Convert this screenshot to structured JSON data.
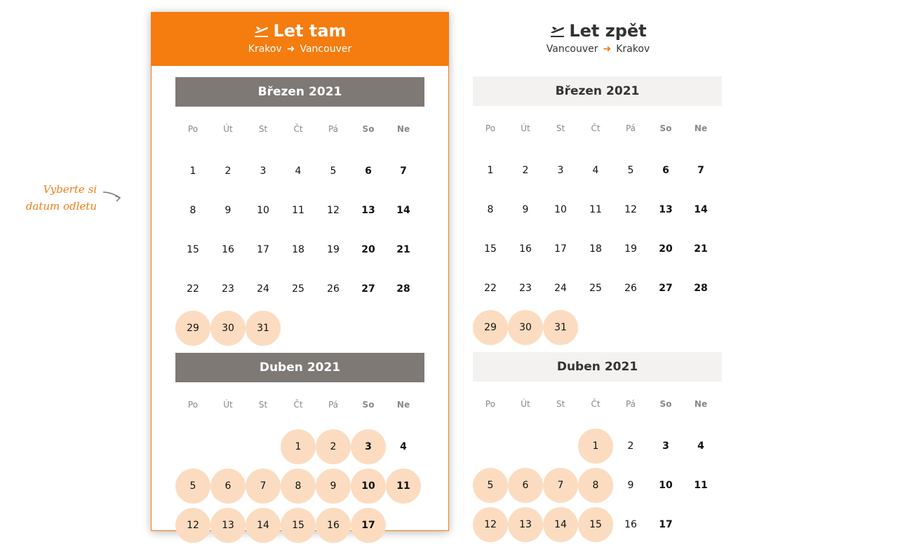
{
  "hint": {
    "text": "Vyberte si datum odletu"
  },
  "columns": [
    {
      "key": "out",
      "title": "Let tam",
      "from": "Krakov",
      "to": "Vancouver",
      "months": [
        {
          "name": "Březen",
          "year": "2021",
          "first_weekday": 0,
          "days": 31,
          "available": [
            29,
            30,
            31
          ]
        },
        {
          "name": "Duben",
          "year": "2021",
          "first_weekday": 3,
          "days": 17,
          "available": [
            1,
            2,
            3,
            5,
            6,
            7,
            8,
            9,
            10,
            11,
            12,
            13,
            14,
            15,
            16,
            17
          ]
        }
      ]
    },
    {
      "key": "ret",
      "title": "Let zpět",
      "from": "Vancouver",
      "to": "Krakov",
      "months": [
        {
          "name": "Březen",
          "year": "2021",
          "first_weekday": 0,
          "days": 31,
          "available": [
            29,
            30,
            31
          ]
        },
        {
          "name": "Duben",
          "year": "2021",
          "first_weekday": 3,
          "days": 17,
          "available": [
            1,
            5,
            6,
            7,
            8,
            12,
            13,
            14,
            15
          ]
        }
      ]
    }
  ],
  "weekdays": [
    "Po",
    "Út",
    "St",
    "Čt",
    "Pá",
    "So",
    "Ne"
  ],
  "route_arrow": "➜",
  "colors": {
    "accent": "#f57c0f",
    "available": "#fcdcc0",
    "month_bar_active": "#7e7975",
    "month_bar_inactive": "#f3f2f1"
  },
  "icons": {
    "plane": "plane-takeoff-icon",
    "hint_arrow": "curved-arrow-icon"
  }
}
